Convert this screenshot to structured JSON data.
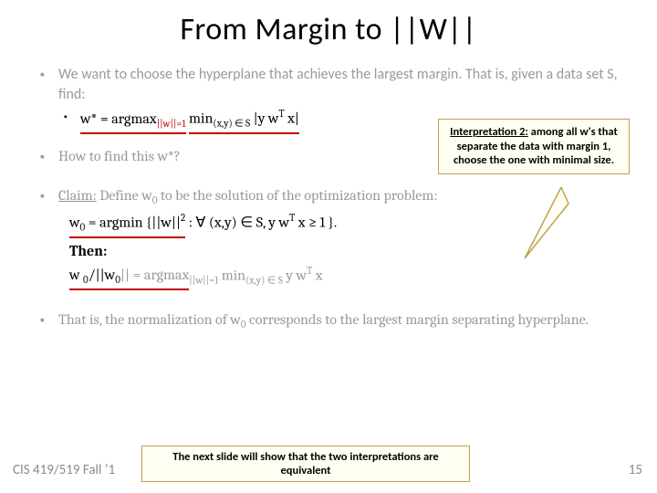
{
  "title": "From Margin to ||W||",
  "bullets": {
    "b1a": "We want to choose the hyperplane that achieves the largest margin. That is, given a data set S, find:",
    "eq1_lhs": "w* = argmax",
    "eq1_cond": "||w||=1",
    "eq1_min": "min",
    "eq1_mincond": "(x,y) ∈ S",
    "eq1_rhs": "|y w",
    "eq1_T": "T",
    "eq1_rhs2": " x|",
    "b1b": "How to find this w*?",
    "b1c_a": "Claim:",
    "b1c_b": " Define w",
    "b1c_sub0": "0",
    "b1c_c": " to be the solution of the optimization problem:",
    "eq2_lhs_a": "w",
    "eq2_lhs_b": " = argmin {||w||",
    "eq2_sq": "2",
    "eq2_mid": " : ∀ (x,y) ∈ S, y w",
    "eq2_T": "T",
    "eq2_end": " x ≥ 1 }.",
    "then": "Then:",
    "eq3_a": "w ",
    "eq3_b": "/||w",
    "eq3_c": "|| = argmax",
    "eq3_cond": "||w||=1",
    "eq3_min": "min",
    "eq3_mincond": "(x,y) ∈ S",
    "eq3_rhs": " y w",
    "eq3_T": "T",
    "eq3_rhs2": " x",
    "b1d_a": "That is, the normalization of w",
    "b1d_b": " corresponds to the largest  margin separating hyperplane."
  },
  "callout": {
    "label": "Interpretation 2:",
    "body": " among all w's that separate the data with margin 1, choose the one with minimal size."
  },
  "note": "The next slide will show that the two interpretations are equivalent",
  "footer": {
    "left": "CIS 419/519 Fall ’1",
    "right": "15"
  }
}
